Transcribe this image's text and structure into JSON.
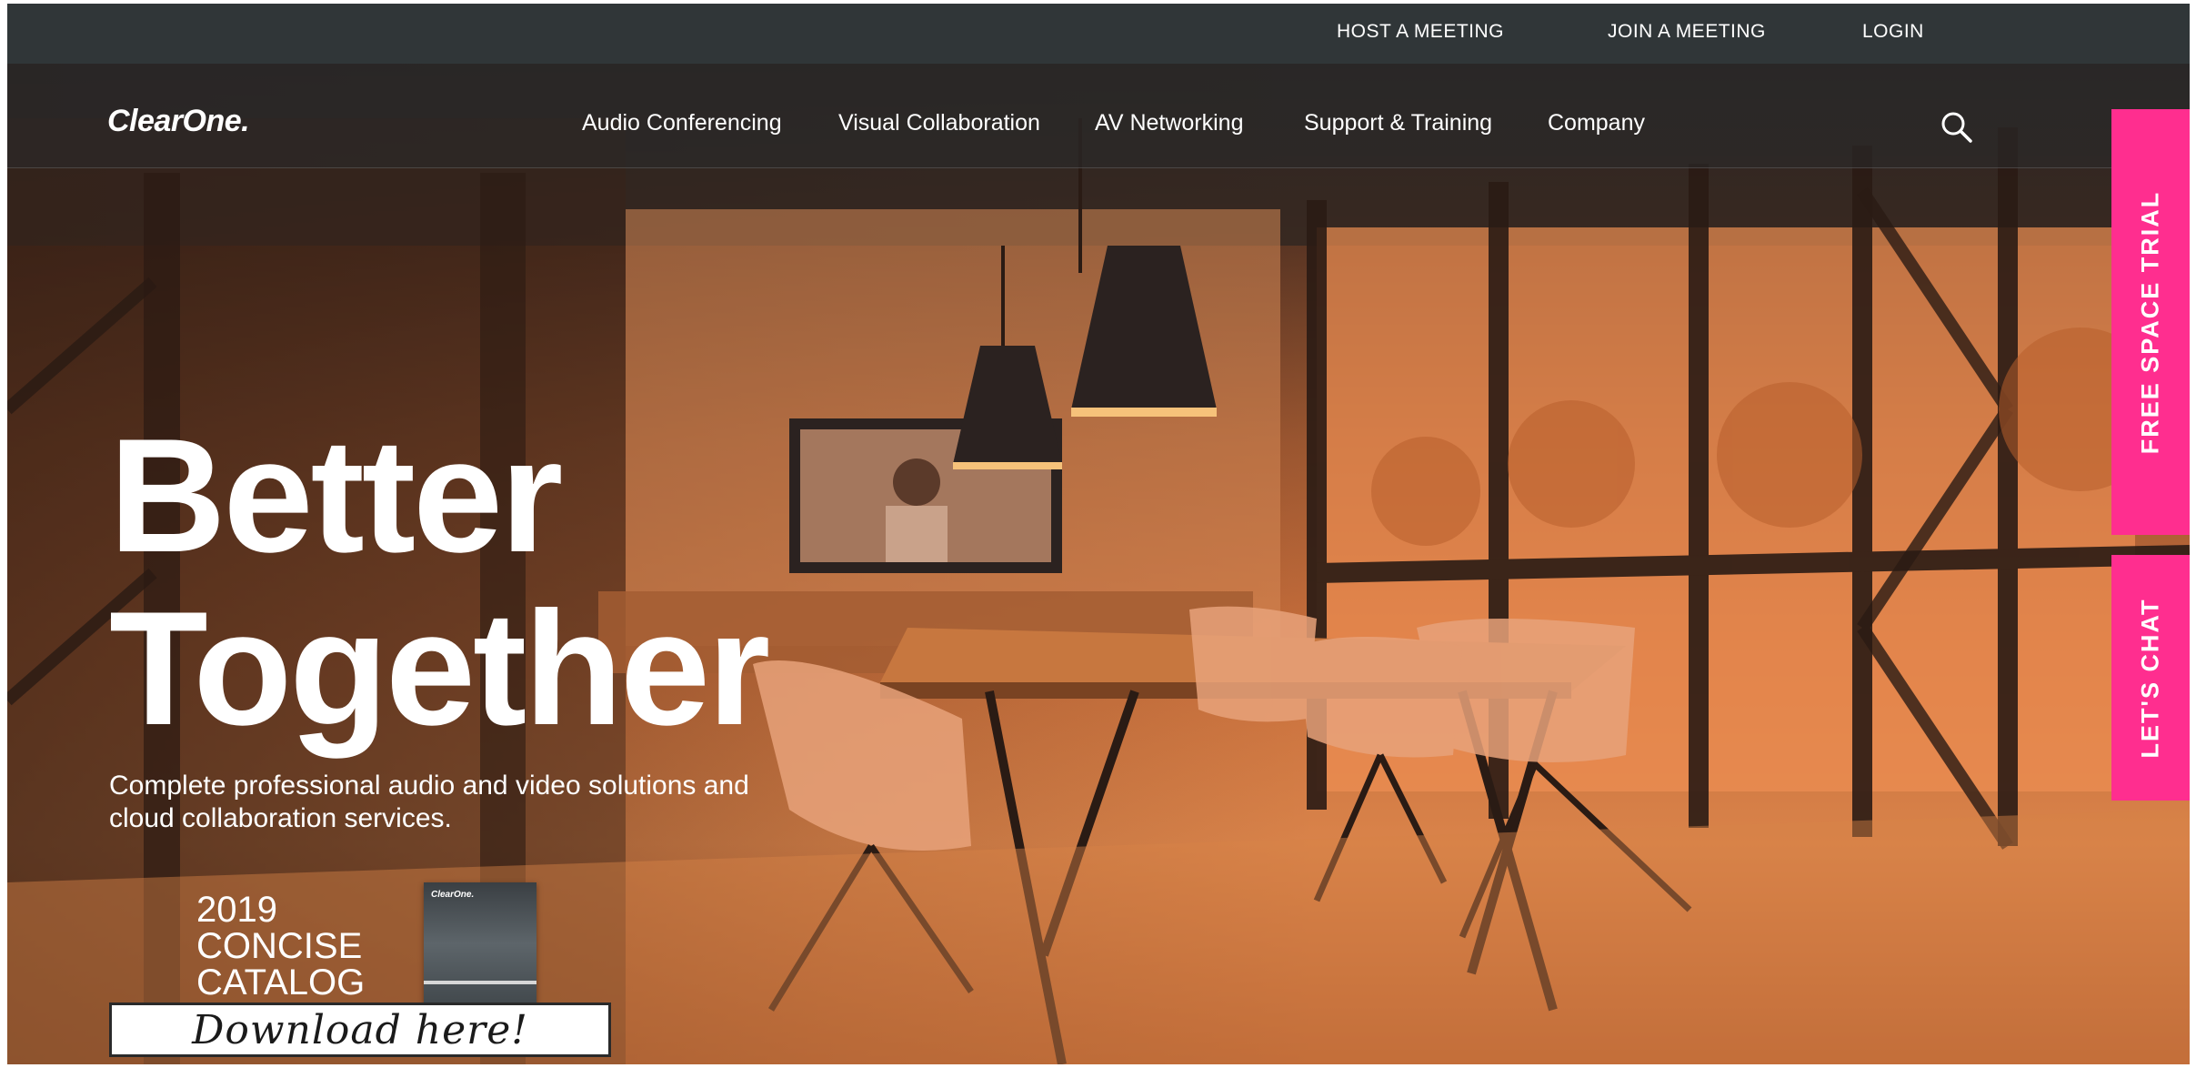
{
  "utility_nav": {
    "host_meeting": "HOST A MEETING",
    "join_meeting": "JOIN A MEETING",
    "login": "LOGIN"
  },
  "brand": {
    "logo_text": "ClearOne."
  },
  "main_nav": {
    "items": [
      {
        "label": "Audio Conferencing"
      },
      {
        "label": "Visual Collaboration"
      },
      {
        "label": "AV Networking"
      },
      {
        "label": "Support & Training"
      },
      {
        "label": "Company"
      }
    ],
    "search_icon": "search-icon"
  },
  "hero": {
    "headline_line1": "Better",
    "headline_line2": "Together",
    "subtitle_line1": "Complete professional audio and video solutions and",
    "subtitle_line2": "cloud collaboration services.",
    "catalog_line1": "2019",
    "catalog_line2": "CONCISE",
    "catalog_line3": "CATALOG",
    "download_label": "Download here!",
    "cover_logo": "ClearOne."
  },
  "side_tabs": {
    "free_trial": "FREE SPACE TRIAL",
    "chat": "LET'S CHAT"
  },
  "colors": {
    "nav_bar": "#303638",
    "accent_pink": "#ff2e8f",
    "hero_tint": "#c76e3b"
  }
}
